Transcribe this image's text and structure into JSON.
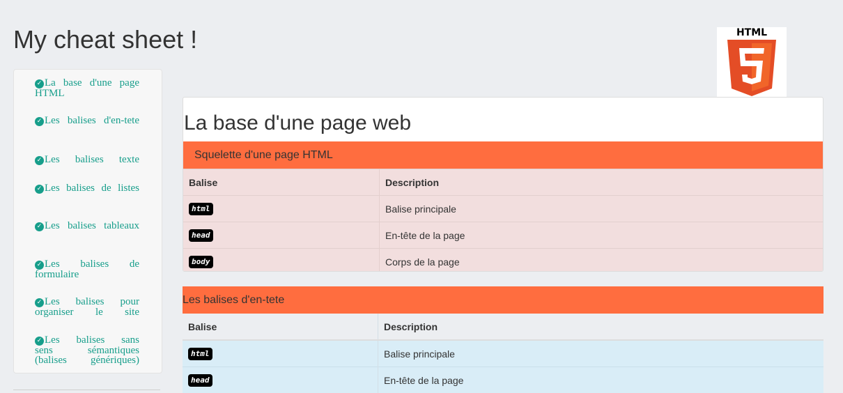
{
  "header": {
    "title": "My cheat sheet !"
  },
  "logo": {
    "text": "HTML",
    "badge": "5",
    "colors": {
      "shield": "#e44d26",
      "shield_light": "#f16529",
      "text": "#000000"
    }
  },
  "sidebar": {
    "items": [
      {
        "label": "La base d'une page HTML"
      },
      {
        "label": "Les balises d'en-tete"
      },
      {
        "label": "Les balises texte"
      },
      {
        "label": "Les balises de listes"
      },
      {
        "label": "Les balises tableaux"
      },
      {
        "label": "Les balises de formulaire"
      },
      {
        "label": "Les balises pour organiser le site"
      },
      {
        "label": "Les balises sans sens sémantiques (balises génériques)"
      }
    ]
  },
  "section1": {
    "title": "La base d'une page web",
    "bar": "Squelette d'une page HTML",
    "headers": [
      "Balise",
      "Description"
    ],
    "rows": [
      {
        "tag": "html",
        "desc": "Balise principale"
      },
      {
        "tag": "head",
        "desc": "En-tête de la page"
      },
      {
        "tag": "body",
        "desc": "Corps de la page"
      }
    ]
  },
  "section2": {
    "bar": "Les balises d'en-tete",
    "headers": [
      "Balise",
      "Description"
    ],
    "rows": [
      {
        "tag": "html",
        "desc": "Balise principale"
      },
      {
        "tag": "head",
        "desc": "En-tête de la page"
      }
    ]
  },
  "colors": {
    "accent": "#ff6d3f",
    "link": "#179e8b",
    "row_danger": "#f2dede",
    "row_info": "#d9edf7"
  }
}
